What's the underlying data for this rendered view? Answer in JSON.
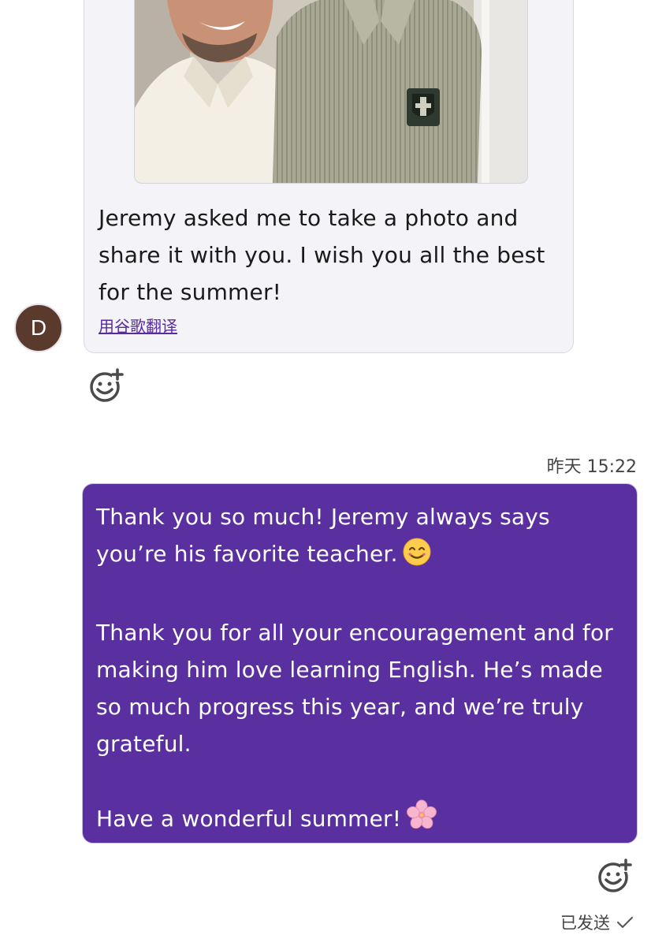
{
  "incoming": {
    "sender_initial": "D",
    "photo": {
      "description_icon": "photo-icon"
    },
    "text": "Jeremy asked me to take a photo and share it with you. I wish you all the best for the summer!",
    "translate_label": "用谷歌翻译"
  },
  "outgoing": {
    "timestamp": "昨天 15:22",
    "para1_text": "Thank you so much! Jeremy always says you’re his favorite teacher.",
    "para1_emoji": "smiling-face-emoji",
    "para2_text": "Thank you for all your encouragement and for making him love learning English. He’s made so much progress this year, and we’re truly grateful.",
    "para3_text": "Have a wonderful summer!",
    "para3_emoji": "cherry-blossom-emoji",
    "status_label": "已发送"
  },
  "colors": {
    "outgoing_bubble": "#5a2fa0",
    "incoming_bubble": "#f3f3f8",
    "link": "#5a2aa3",
    "avatar": "#5b3a2e"
  }
}
